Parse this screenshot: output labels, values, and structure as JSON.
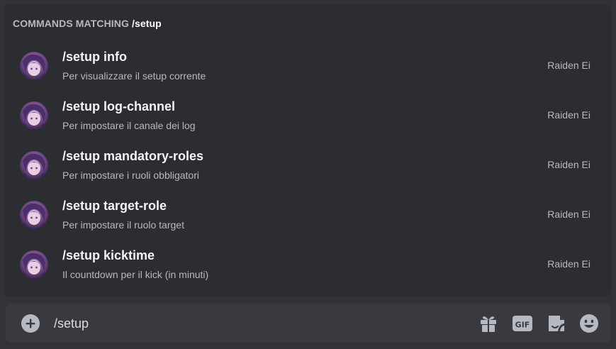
{
  "autocomplete": {
    "header_prefix": "COMMANDS MATCHING",
    "header_query": "/setup",
    "commands": [
      {
        "name": "/setup info",
        "description": "Per visualizzare il setup corrente",
        "source": "Raiden Ei"
      },
      {
        "name": "/setup log-channel",
        "description": "Per impostare il canale dei log",
        "source": "Raiden Ei"
      },
      {
        "name": "/setup mandatory-roles",
        "description": "Per impostare i ruoli obbligatori",
        "source": "Raiden Ei"
      },
      {
        "name": "/setup target-role",
        "description": "Per impostare il ruolo target",
        "source": "Raiden Ei"
      },
      {
        "name": "/setup kicktime",
        "description": "Il countdown per il kick (in minuti)",
        "source": "Raiden Ei"
      }
    ]
  },
  "composer": {
    "value": "/setup",
    "icons": [
      "plus-circle-icon",
      "gift-icon",
      "gif-icon",
      "sticker-icon",
      "emoji-icon"
    ],
    "gif_label": "GIF"
  },
  "colors": {
    "background": "#313338",
    "popup": "#2b2d31",
    "input": "#383a40",
    "icon": "#b5bac1"
  }
}
